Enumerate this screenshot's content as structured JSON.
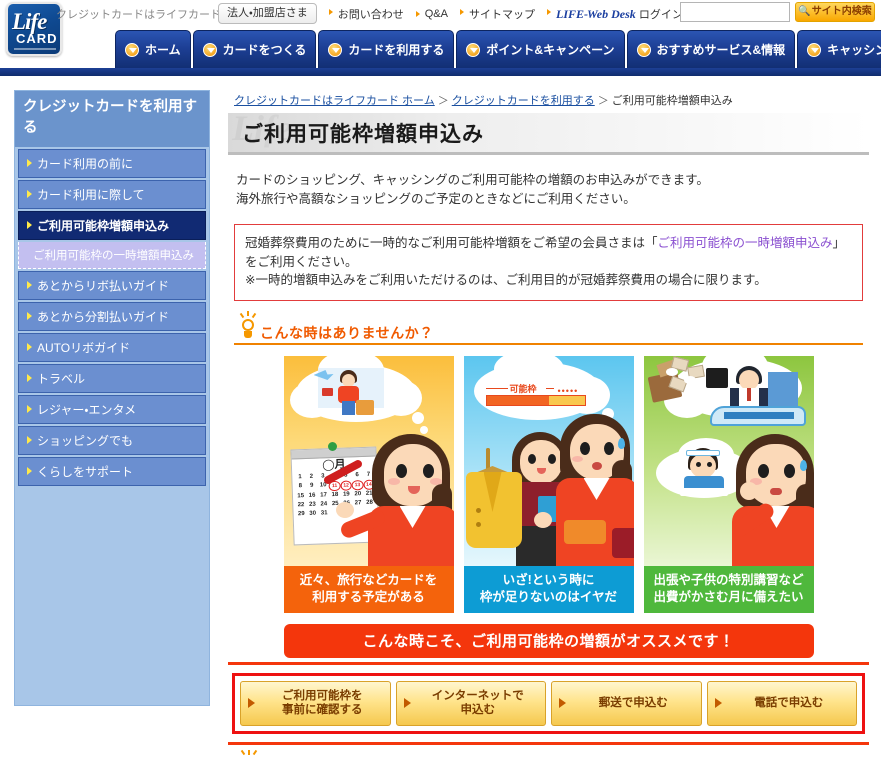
{
  "header": {
    "logo": {
      "life": "Life",
      "card": "CARD"
    },
    "tagline": "クレジットカードはライフカード",
    "corporate_button": "法人・加盟店さま",
    "util_links": [
      "お問い合わせ",
      "Q&A",
      "サイトマップ"
    ],
    "webdesk": {
      "brand": "LIFE-Web Desk",
      "login": "ログイン"
    },
    "search": {
      "value": "",
      "placeholder": "",
      "button": "サイト内検索"
    }
  },
  "global_nav": [
    {
      "label": "ホーム"
    },
    {
      "label": "カードをつくる"
    },
    {
      "label": "カードを利用する"
    },
    {
      "label": "ポイント&キャンペーン"
    },
    {
      "label": "おすすめサービス&情報"
    },
    {
      "label": "キャッシング&ローン"
    }
  ],
  "sidebar": {
    "heading": "クレジットカードを利用する",
    "items": [
      {
        "label": "カード利用の前に",
        "active": false
      },
      {
        "label": "カード利用に際して",
        "active": false
      },
      {
        "label": "ご利用可能枠増額申込み",
        "active": true
      },
      {
        "label": "あとからリボ払いガイド",
        "active": false
      },
      {
        "label": "あとから分割払いガイド",
        "active": false
      },
      {
        "label": "AUTOリボガイド",
        "active": false
      },
      {
        "label": "トラベル",
        "active": false
      },
      {
        "label": "レジャー・エンタメ",
        "active": false
      },
      {
        "label": "ショッピングでも",
        "active": false
      },
      {
        "label": "くらしをサポート",
        "active": false
      }
    ],
    "sub_item": "ご利用可能枠の一時増額申込み"
  },
  "breadcrumb": {
    "home": "クレジットカードはライフカード ホーム",
    "parent": "クレジットカードを利用する",
    "current": "ご利用可能枠増額申込み",
    "separator": "＞"
  },
  "main": {
    "title": "ご利用可能枠増額申込み",
    "intro_line1": "カードのショッピング、キャッシングのご利用可能枠の増額のお申込みができます。",
    "intro_line2": "海外旅行や高額なショッピングのご予定のときなどにご利用ください。",
    "notice": {
      "prefix": "冠婚葬祭費用のために一時的なご利用可能枠増額をご希望の会員さまは「",
      "link": "ご利用可能枠の一時増額申込み",
      "suffix": "」をご利用ください。",
      "line2": "※一時的増額申込みをご利用いただけるのは、ご利用目的が冠婚葬祭費用の場合に限ります。"
    },
    "section_heading": "こんな時はありませんか？",
    "cards": [
      {
        "caption_line1": "近々、旅行などカードを",
        "caption_line2": "利用する予定がある",
        "calendar": {
          "month_label": "◯月",
          "days": [
            "1",
            "2",
            "3",
            "4",
            "5",
            "6",
            "7",
            "8",
            "9",
            "10",
            "11",
            "12",
            "13",
            "14",
            "15",
            "16",
            "17",
            "18",
            "19",
            "20",
            "21",
            "22",
            "23",
            "24",
            "25",
            "26",
            "27",
            "28",
            "29",
            "30",
            "31"
          ],
          "marked": [
            "11",
            "12",
            "13",
            "14"
          ]
        }
      },
      {
        "caption_line1": "いざ!という時に",
        "caption_line2": "枠が足りないのはイヤだ",
        "frame_label": "可能枠",
        "frame_dots": "•••••"
      },
      {
        "caption_line1": "出張や子供の特別講習など",
        "caption_line2": "出費がかさむ月に備えたい"
      }
    ],
    "banner": "こんな時こそ、ご利用可能枠の増額がオススメです！",
    "actions": [
      {
        "line1": "ご利用可能枠を",
        "line2": "事前に確認する"
      },
      {
        "line1": "インターネットで",
        "line2": "申込む"
      },
      {
        "line1": "郵送で申込む",
        "line2": ""
      },
      {
        "line1": "電話で申込む",
        "line2": ""
      }
    ]
  },
  "colors": {
    "nav_blue": "#1d3f95",
    "accent_orange": "#f05a00",
    "banner_red": "#f4360c",
    "notice_red": "#e23c3c",
    "card1": "#f4630c",
    "card2": "#0d9cd4",
    "card3": "#4fb83c",
    "sidebar_bg": "#a8c6e8",
    "sidebar_active": "#112a73"
  }
}
